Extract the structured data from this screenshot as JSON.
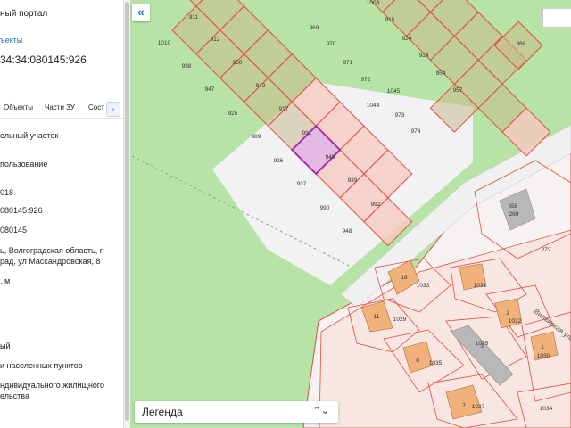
{
  "sidebar": {
    "portal_title": "ный портал",
    "objects_link": "ъекты",
    "cad_number": "34:34:080145:926",
    "tabs": [
      {
        "label": "Объекты"
      },
      {
        "label": "Части ЗУ"
      },
      {
        "label": "Сост"
      }
    ],
    "tabs_next": "›",
    "fields": [
      {
        "text": "ельный участок"
      },
      {
        "text": "пользование"
      },
      {
        "text": "018"
      },
      {
        "text": "080145:926"
      },
      {
        "text": "080145"
      },
      {
        "text": "ь, Волгоградская область, г"
      },
      {
        "text": "рад, ул Массандровская, 8"
      },
      {
        "text": ". м"
      },
      {
        "text": "ый"
      },
      {
        "text": "и населенных пунктов"
      },
      {
        "text": "ндивидуального жилищного"
      },
      {
        "text": "ельства"
      }
    ]
  },
  "map": {
    "collapse_icon": "«",
    "legend_label": "Легенда",
    "legend_chevron": "⌃⌄",
    "street_label": "Вилвиская ули",
    "colors": {
      "background": "#b7e4a6",
      "parcel_fill": "#f5c9c0",
      "parcel_border": "#e34d3c",
      "selected_fill": "#e3b9e6",
      "selected_border": "#a72fa8",
      "building_fill": "#f0b27a",
      "clearing": "#f2f2f5"
    },
    "parcels": [
      {
        "n": "911"
      },
      {
        "n": "1010"
      },
      {
        "n": "912"
      },
      {
        "n": "938"
      },
      {
        "n": "950"
      },
      {
        "n": "947"
      },
      {
        "n": "942"
      },
      {
        "n": "925"
      },
      {
        "n": "917"
      },
      {
        "n": "989"
      },
      {
        "n": "991"
      },
      {
        "n": "926"
      },
      {
        "n": "949"
      },
      {
        "n": "937"
      },
      {
        "n": "939"
      },
      {
        "n": "990"
      },
      {
        "n": "992"
      },
      {
        "n": "948"
      },
      {
        "n": "1009"
      },
      {
        "n": "969"
      },
      {
        "n": "915"
      },
      {
        "n": "970"
      },
      {
        "n": "924"
      },
      {
        "n": "971"
      },
      {
        "n": "914"
      },
      {
        "n": "972"
      },
      {
        "n": "954"
      },
      {
        "n": "1045"
      },
      {
        "n": "957"
      },
      {
        "n": "1044"
      },
      {
        "n": "973"
      },
      {
        "n": "974"
      },
      {
        "n": "968"
      },
      {
        "n": "658"
      },
      {
        "n": "269"
      },
      {
        "n": "272"
      },
      {
        "n": "1033"
      },
      {
        "n": "1031"
      },
      {
        "n": "1032"
      },
      {
        "n": "1029"
      },
      {
        "n": "1075"
      },
      {
        "n": "1030"
      },
      {
        "n": "1035"
      },
      {
        "n": "1027"
      },
      {
        "n": "1034"
      },
      {
        "n": "18"
      },
      {
        "n": "11"
      },
      {
        "n": "8"
      },
      {
        "n": "7"
      },
      {
        "n": "2"
      },
      {
        "n": "1"
      },
      {
        "n": "3"
      }
    ]
  }
}
